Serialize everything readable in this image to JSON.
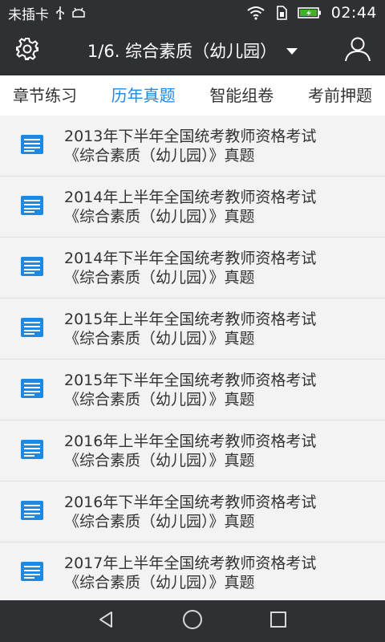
{
  "status_bar": {
    "carrier": "未插卡",
    "time": "02:44",
    "icons": [
      "usb-icon",
      "android-debug-icon",
      "wifi-icon",
      "sim-icon",
      "battery-charging-icon"
    ]
  },
  "app_bar": {
    "title": "1/6. 综合素质（幼儿园）",
    "left_icon": "gear-icon",
    "right_icon": "user-icon"
  },
  "tabs": [
    {
      "label": "章节练习",
      "active": false
    },
    {
      "label": "历年真题",
      "active": true
    },
    {
      "label": "智能组卷",
      "active": false
    },
    {
      "label": "考前押题",
      "active": false
    }
  ],
  "items": [
    {
      "line1": "2013年下半年全国统考教师资格考试",
      "line2": "《综合素质（幼儿园）》真题"
    },
    {
      "line1": "2014年上半年全国统考教师资格考试",
      "line2": "《综合素质（幼儿园）》真题"
    },
    {
      "line1": "2014年下半年全国统考教师资格考试",
      "line2": "《综合素质（幼儿园）》真题"
    },
    {
      "line1": "2015年上半年全国统考教师资格考试",
      "line2": "《综合素质（幼儿园）》真题"
    },
    {
      "line1": "2015年下半年全国统考教师资格考试",
      "line2": "《综合素质（幼儿园）》真题"
    },
    {
      "line1": "2016年上半年全国统考教师资格考试",
      "line2": "《综合素质（幼儿园）》真题"
    },
    {
      "line1": "2016年下半年全国统考教师资格考试",
      "line2": "《综合素质（幼儿园）》真题"
    },
    {
      "line1": "2017年上半年全国统考教师资格考试",
      "line2": "《综合素质（幼儿园）》真题"
    }
  ],
  "colors": {
    "bar": "#2f3033",
    "accent": "#1e88e5",
    "list_bg": "#f3f3f3",
    "text": "#333333"
  },
  "nav": [
    "back-icon",
    "home-icon",
    "recents-icon"
  ]
}
